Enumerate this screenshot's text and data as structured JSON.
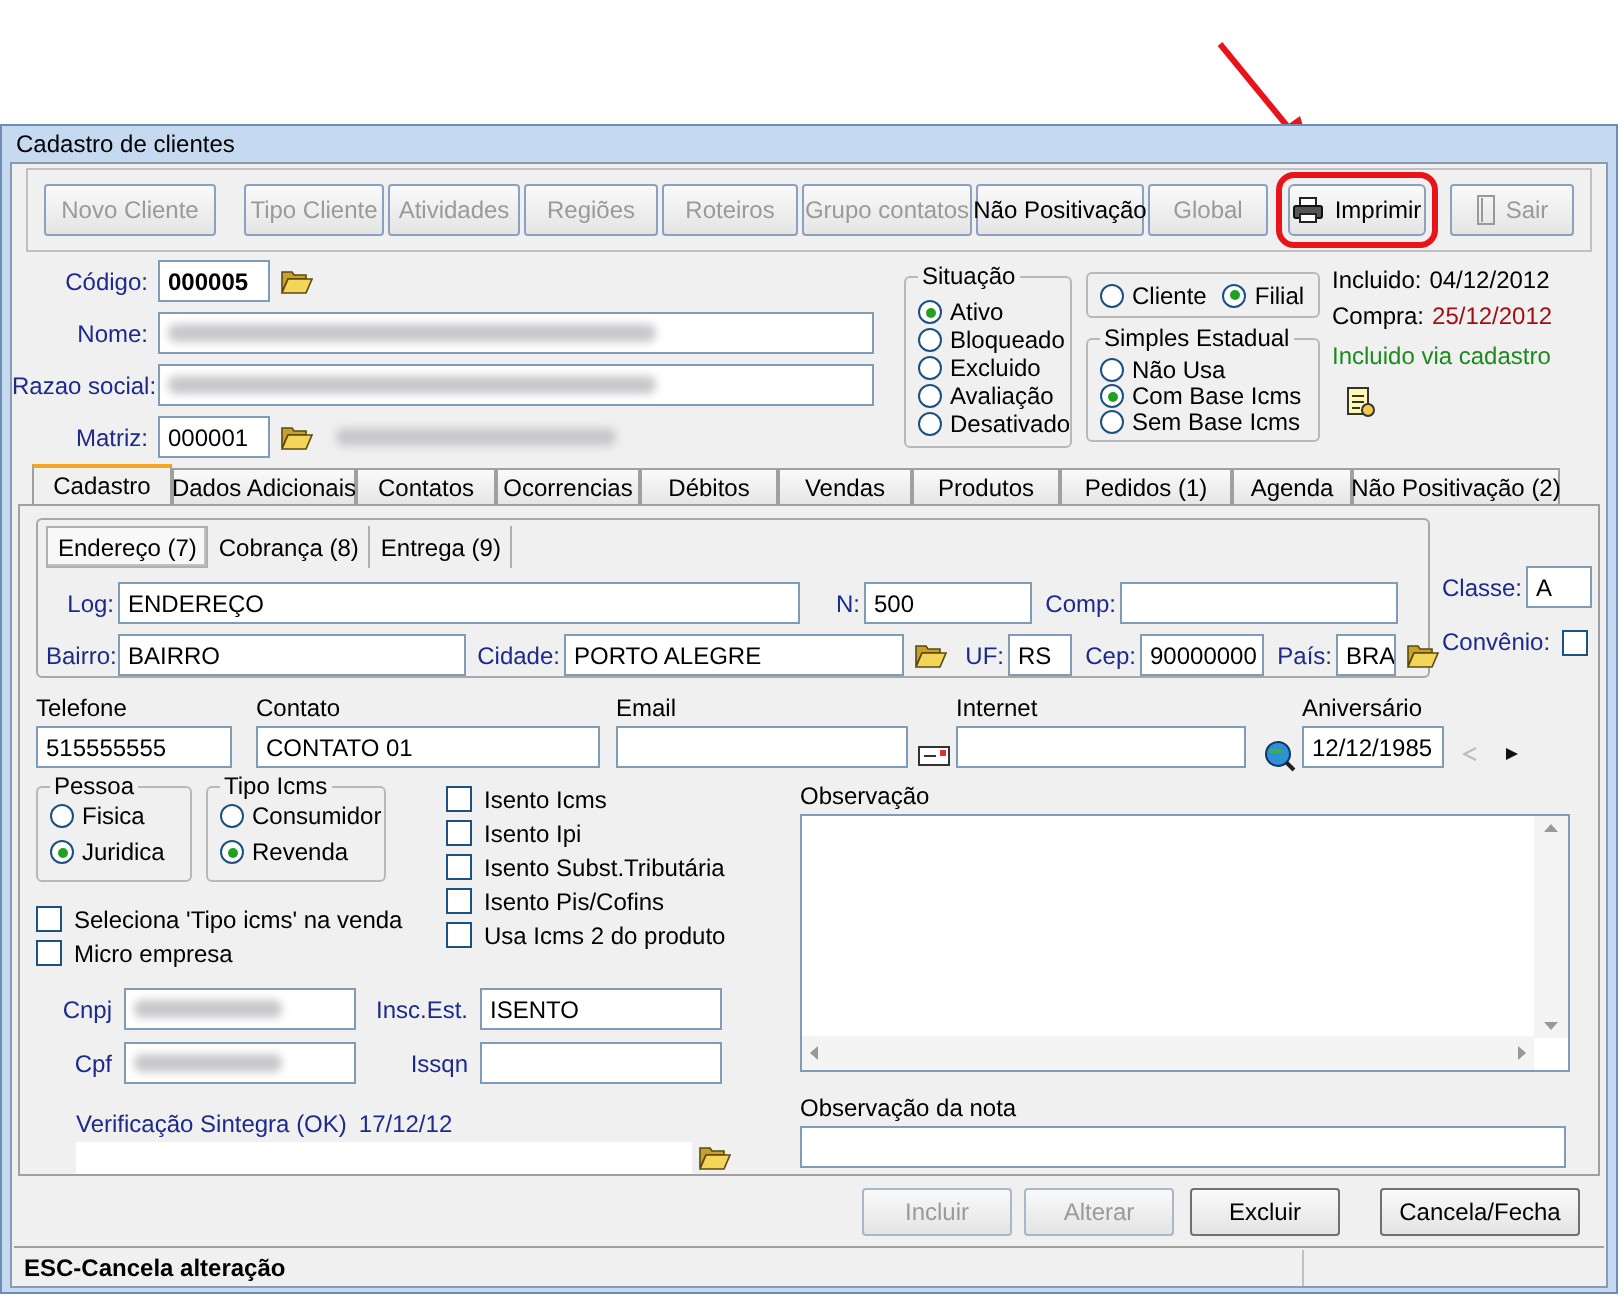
{
  "window": {
    "title": "Cadastro de clientes"
  },
  "toolbar": [
    {
      "buttons": [
        {
          "label": "Novo Cliente",
          "disabled": true,
          "kind": "button",
          "highlighted": false
        }
      ]
    },
    {
      "buttons": [
        {
          "label": "Tipo Cliente",
          "disabled": true,
          "kind": "button",
          "highlighted": false
        },
        {
          "label": "Atividades",
          "disabled": true,
          "kind": "button",
          "highlighted": false
        },
        {
          "label": "Regiões",
          "disabled": true,
          "kind": "button",
          "highlighted": false
        },
        {
          "label": "Roteiros",
          "disabled": true,
          "kind": "button",
          "highlighted": false
        },
        {
          "label": "Grupo contatos",
          "disabled": true,
          "kind": "button",
          "highlighted": false
        },
        {
          "label": "Não Positivação",
          "disabled": false,
          "kind": "button",
          "highlighted": false
        },
        {
          "label": "Global",
          "disabled": true,
          "kind": "button",
          "highlighted": false
        }
      ]
    },
    {
      "buttons": [
        {
          "label": "Imprimir",
          "disabled": false,
          "kind": "print",
          "highlighted": true
        }
      ]
    },
    {
      "buttons": [
        {
          "label": "Sair",
          "disabled": true,
          "kind": "exit",
          "highlighted": false
        }
      ]
    }
  ],
  "codigo": {
    "label": "Código:",
    "value": "000005"
  },
  "nome": {
    "label": "Nome:",
    "redacted": true
  },
  "razao_social": {
    "label": "Razao social:",
    "redacted": true
  },
  "matriz": {
    "label": "Matriz:",
    "value": "000001",
    "name_redacted": true
  },
  "situacao": {
    "title": "Situação",
    "options": [
      {
        "label": "Ativo",
        "selected": true
      },
      {
        "label": "Bloqueado",
        "selected": false
      },
      {
        "label": "Excluido",
        "selected": false
      },
      {
        "label": "Avaliação",
        "selected": false
      },
      {
        "label": "Desativado",
        "selected": false
      }
    ]
  },
  "tipo": [
    {
      "label": "Cliente",
      "selected": false
    },
    {
      "label": "Filial",
      "selected": true
    }
  ],
  "simples_estadual": {
    "title": "Simples Estadual",
    "options": [
      {
        "label": "Não Usa",
        "selected": false
      },
      {
        "label": "Com Base Icms",
        "selected": true
      },
      {
        "label": "Sem Base Icms",
        "selected": false
      }
    ]
  },
  "info": {
    "incluido_label": "Incluido:",
    "incluido": "04/12/2012",
    "compra_label": "Compra:",
    "compra": "25/12/2012",
    "note": "Incluido via cadastro"
  },
  "tabs": [
    {
      "label": "Cadastro",
      "selected": true
    },
    {
      "label": "Dados Adicionais",
      "selected": false
    },
    {
      "label": "Contatos",
      "selected": false
    },
    {
      "label": "Ocorrencias",
      "selected": false
    },
    {
      "label": "Débitos",
      "selected": false
    },
    {
      "label": "Vendas",
      "selected": false
    },
    {
      "label": "Produtos",
      "selected": false
    },
    {
      "label": "Pedidos (1)",
      "selected": false
    },
    {
      "label": "Agenda",
      "selected": false
    },
    {
      "label": "Não Positivação (2)",
      "selected": false
    }
  ],
  "address": {
    "tabs": [
      {
        "label": "Endereço (7)",
        "selected": true
      },
      {
        "label": "Cobrança (8)",
        "selected": false
      },
      {
        "label": "Entrega (9)",
        "selected": false
      }
    ],
    "log": {
      "label": "Log:",
      "value": "ENDEREÇO"
    },
    "numero": {
      "label": "N:",
      "value": "500"
    },
    "comp": {
      "label": "Comp:"
    },
    "bairro": {
      "label": "Bairro:",
      "value": "BAIRRO"
    },
    "cidade": {
      "label": "Cidade:",
      "value": "PORTO ALEGRE"
    },
    "uf": {
      "label": "UF:",
      "value": "RS"
    },
    "cep": {
      "label": "Cep:",
      "value": "90000000"
    },
    "pais": {
      "label": "País:",
      "value": "BRA"
    }
  },
  "classe": {
    "label": "Classe:",
    "value": "A"
  },
  "convenio": {
    "label": "Convênio:",
    "checked": false
  },
  "telefone": {
    "label": "Telefone",
    "value": "515555555"
  },
  "contato": {
    "label": "Contato",
    "value": "CONTATO 01"
  },
  "email": {
    "label": "Email"
  },
  "internet": {
    "label": "Internet"
  },
  "aniversario": {
    "label": "Aniversário",
    "value": "12/12/1985"
  },
  "pessoa": {
    "title": "Pessoa",
    "options": [
      {
        "label": "Fisica",
        "selected": false
      },
      {
        "label": "Juridica",
        "selected": true
      }
    ]
  },
  "tipo_icms": {
    "title": "Tipo Icms",
    "options": [
      {
        "label": "Consumidor",
        "selected": false
      },
      {
        "label": "Revenda",
        "selected": true
      }
    ]
  },
  "flags": [
    {
      "label": "Isento Icms",
      "checked": false
    },
    {
      "label": "Isento Ipi",
      "checked": false
    },
    {
      "label": "Isento Subst.Tributária",
      "checked": false
    },
    {
      "label": "Isento Pis/Cofins",
      "checked": false
    },
    {
      "label": "Usa Icms 2 do produto",
      "checked": false
    }
  ],
  "options": [
    {
      "label": "Seleciona 'Tipo icms' na venda",
      "checked": false
    },
    {
      "label": "Micro empresa",
      "checked": false
    }
  ],
  "cnpj": {
    "label": "Cnpj",
    "redacted": true
  },
  "cpf": {
    "label": "Cpf",
    "redacted": true
  },
  "insc_est": {
    "label": "Insc.Est.",
    "value": "ISENTO"
  },
  "issqn": {
    "label": "Issqn"
  },
  "sintegra": {
    "label": "Verificação Sintegra (OK)",
    "date": "17/12/12"
  },
  "observacao": {
    "label": "Observação"
  },
  "observacao_nota": {
    "label": "Observação da nota"
  },
  "actions": [
    {
      "label": "Incluir",
      "disabled": true
    },
    {
      "label": "Alterar",
      "disabled": true
    },
    {
      "label": "Excluir",
      "disabled": false
    },
    {
      "label": "Cancela/Fecha",
      "disabled": false
    }
  ],
  "status_bar": {
    "text": "ESC-Cancela alteração"
  }
}
